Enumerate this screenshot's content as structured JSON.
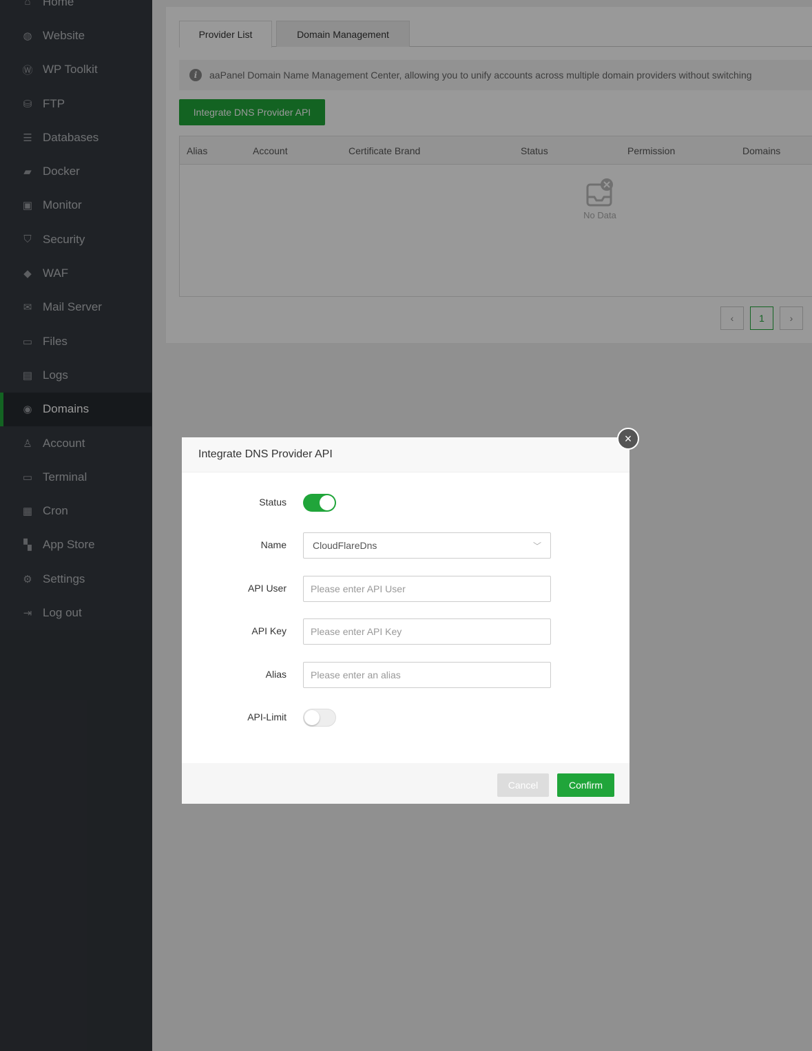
{
  "sidebar": {
    "items": [
      {
        "label": "Home",
        "icon": "home-icon",
        "glyph": "⌂"
      },
      {
        "label": "Website",
        "icon": "globe-icon",
        "glyph": "◍"
      },
      {
        "label": "WP Toolkit",
        "icon": "wordpress-icon",
        "glyph": "Ⓦ"
      },
      {
        "label": "FTP",
        "icon": "ftp-icon",
        "glyph": "⛁"
      },
      {
        "label": "Databases",
        "icon": "database-icon",
        "glyph": "☰"
      },
      {
        "label": "Docker",
        "icon": "docker-icon",
        "glyph": "▰"
      },
      {
        "label": "Monitor",
        "icon": "monitor-icon",
        "glyph": "▣"
      },
      {
        "label": "Security",
        "icon": "shield-icon",
        "glyph": "⛉"
      },
      {
        "label": "WAF",
        "icon": "waf-shield-icon",
        "glyph": "◆"
      },
      {
        "label": "Mail Server",
        "icon": "mail-icon",
        "glyph": "✉"
      },
      {
        "label": "Files",
        "icon": "folder-icon",
        "glyph": "▭"
      },
      {
        "label": "Logs",
        "icon": "logs-icon",
        "glyph": "▤"
      },
      {
        "label": "Domains",
        "icon": "www-icon",
        "glyph": "◉"
      },
      {
        "label": "Account",
        "icon": "user-icon",
        "glyph": "♙"
      },
      {
        "label": "Terminal",
        "icon": "terminal-icon",
        "glyph": "▭"
      },
      {
        "label": "Cron",
        "icon": "calendar-icon",
        "glyph": "▦"
      },
      {
        "label": "App Store",
        "icon": "apps-icon",
        "glyph": "▚"
      },
      {
        "label": "Settings",
        "icon": "gear-icon",
        "glyph": "⚙"
      },
      {
        "label": "Log out",
        "icon": "logout-icon",
        "glyph": "⇥"
      }
    ],
    "active": "Domains"
  },
  "tabs": [
    "Provider List",
    "Domain Management"
  ],
  "notice": "aaPanel Domain Name Management Center, allowing you to unify accounts across multiple domain providers without switching",
  "integrate_button": "Integrate DNS Provider API",
  "table": {
    "columns": [
      "Alias",
      "Account",
      "Certificate Brand",
      "Status",
      "Permission",
      "Domains"
    ],
    "empty_text": "No Data"
  },
  "pagination": {
    "prev": "‹",
    "page": "1",
    "next": "›"
  },
  "modal": {
    "title": "Integrate DNS Provider API",
    "close": "×",
    "fields": {
      "status": {
        "label": "Status",
        "on": true
      },
      "name": {
        "label": "Name",
        "value": "CloudFlareDns"
      },
      "api_user": {
        "label": "API User",
        "placeholder": "Please enter API User"
      },
      "api_key": {
        "label": "API Key",
        "placeholder": "Please enter API Key"
      },
      "alias": {
        "label": "Alias",
        "placeholder": "Please enter an alias"
      },
      "api_limit": {
        "label": "API-Limit",
        "on": false
      }
    },
    "cancel": "Cancel",
    "confirm": "Confirm"
  },
  "colors": {
    "accent": "#20a53a",
    "sidebar": "#33373d"
  }
}
